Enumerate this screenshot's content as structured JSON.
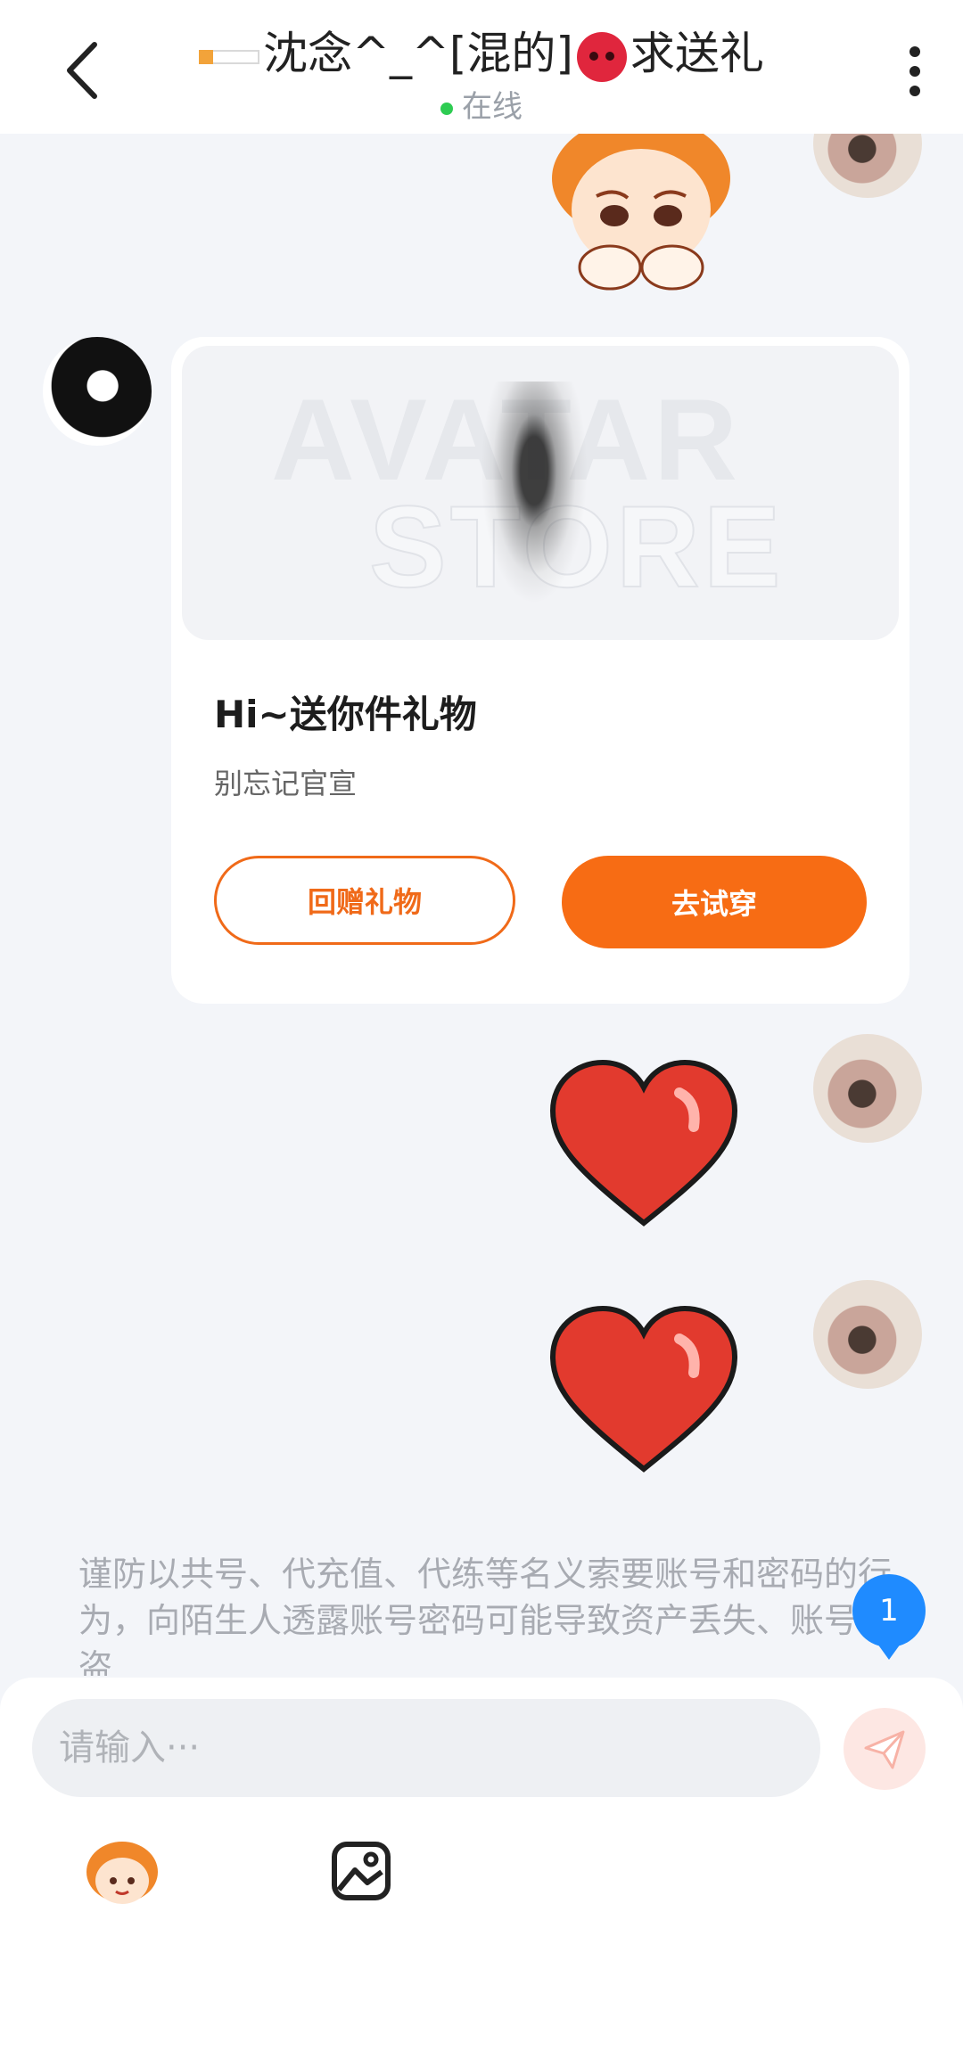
{
  "header": {
    "title_prefix": "沈念^_^[混的]",
    "title_suffix": "求送礼",
    "status": "在线"
  },
  "gift_card": {
    "watermark_line1": "AVATAR",
    "watermark_line2": "STORE",
    "title": "Hi~送你件礼物",
    "subtitle": "别忘记官宣",
    "return_label": "回赠礼物",
    "try_label": "去试穿"
  },
  "notice": "谨防以共号、代充值、代练等名义索要账号和密码的行为，向陌生人透露账号密码可能导致资产丢失、账号被盗",
  "unread_badge": "1",
  "input": {
    "placeholder": "请输入···"
  },
  "colors": {
    "accent": "#f76c14",
    "badge": "#1f8bff",
    "online": "#2ecc52"
  },
  "icons": [
    "back-arrow-icon",
    "more-icon",
    "heart-icon",
    "send-icon",
    "sticker-icon",
    "image-icon",
    "menu-icon",
    "home-icon",
    "return-icon"
  ]
}
